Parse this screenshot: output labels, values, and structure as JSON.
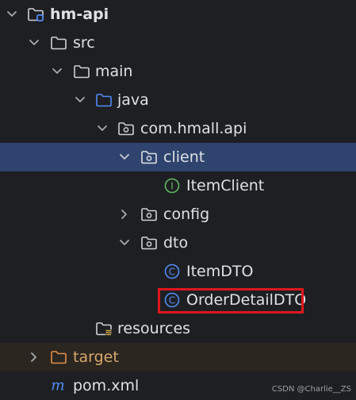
{
  "tree": {
    "project": {
      "label": "hm-api"
    },
    "src": {
      "label": "src"
    },
    "main": {
      "label": "main"
    },
    "java": {
      "label": "java"
    },
    "package": {
      "label": "com.hmall.api"
    },
    "client": {
      "label": "client"
    },
    "item_client": {
      "label": "ItemClient",
      "icon_letter": "I"
    },
    "config": {
      "label": "config"
    },
    "dto": {
      "label": "dto"
    },
    "item_dto": {
      "label": "ItemDTO",
      "icon_letter": "C"
    },
    "order_detail_dto": {
      "label": "OrderDetailDTO",
      "icon_letter": "C"
    },
    "resources": {
      "label": "resources"
    },
    "target": {
      "label": "target"
    },
    "pom": {
      "label": "pom.xml",
      "icon_letter": "m"
    }
  },
  "watermark": "CSDN @Charlie__ZS",
  "colors": {
    "background": "#1e1f22",
    "selection": "#2e436e",
    "excluded_row": "#2b2620",
    "highlight_border": "#e0161e",
    "class_icon": "#548af7",
    "interface_icon": "#5fb865",
    "maven_icon": "#4f8cf7",
    "excluded_folder": "#e0904a",
    "source_folder": "#548af7"
  }
}
